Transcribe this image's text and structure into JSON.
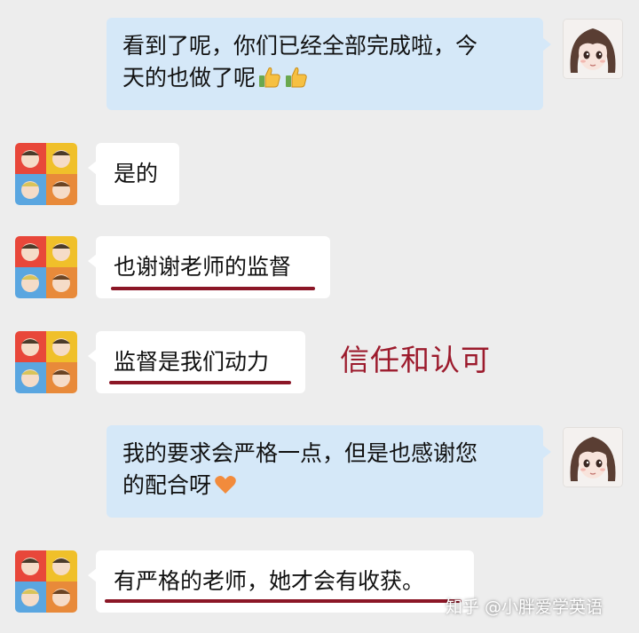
{
  "messages": [
    {
      "side": "right",
      "text_lines": [
        "看到了呢，你们已经全部完成啦，今",
        "天的也做了呢"
      ],
      "emoji": "thumbs-up-icon"
    },
    {
      "side": "left",
      "text": "是的"
    },
    {
      "side": "left",
      "text": "也谢谢老师的监督"
    },
    {
      "side": "left",
      "text": "监督是我们动力"
    },
    {
      "side": "right",
      "text_lines": [
        "我的要求会严格一点，但是也感谢您",
        "的配合呀"
      ],
      "emoji": "orange-heart-icon"
    },
    {
      "side": "left",
      "text": "有严格的老师，她才会有收获。"
    }
  ],
  "annotation": "信任和认可",
  "watermark": "知乎 @小胖爱学英语",
  "colors": {
    "background": "#ededed",
    "right_bubble": "#d5e8f8",
    "left_bubble": "#ffffff",
    "underline": "#8b1626",
    "annotation": "#9c1a2c"
  }
}
